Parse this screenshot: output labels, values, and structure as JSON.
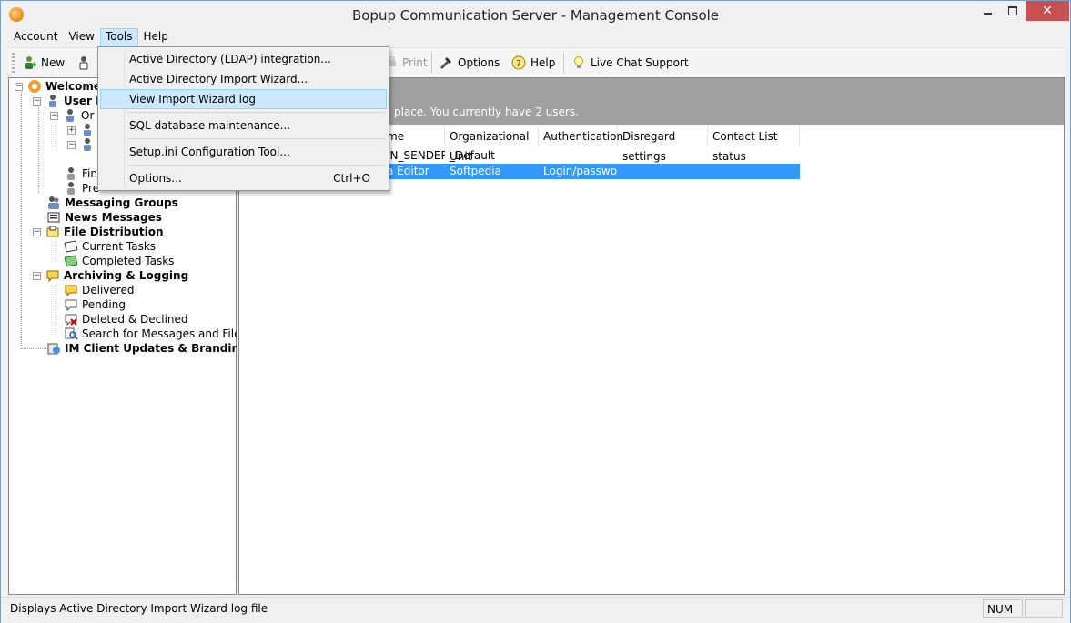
{
  "window": {
    "title": "Bopup Communication Server - Management Console",
    "close_glyph": "✕"
  },
  "menubar": {
    "items": [
      {
        "label": "Account"
      },
      {
        "label": "View"
      },
      {
        "label": "Tools"
      },
      {
        "label": "Help"
      }
    ],
    "active": "Tools"
  },
  "toolbar": {
    "new_label": "New",
    "print_label": "Print",
    "options_label": "Options",
    "help_label": "Help",
    "live_chat_label": "Live Chat Support"
  },
  "tree": {
    "welcome": "Welcome",
    "user_management": "User M",
    "org_units": "Or",
    "find_users": "Fin",
    "presence": "Pre",
    "messaging_groups": "Messaging Groups",
    "news_messages": "News Messages",
    "file_distribution": "File Distribution",
    "current_tasks": "Current Tasks",
    "completed_tasks": "Completed Tasks",
    "archiving_logging": "Archiving & Logging",
    "delivered": "Delivered",
    "pending": "Pending",
    "deleted_declined": "Deleted & Declined",
    "search_messages": "Search for Messages and Files",
    "im_client_updates": "IM Client Updates & Branding"
  },
  "content": {
    "banner_text": "place. You currently have 2 users.",
    "columns": [
      {
        "label": "me"
      },
      {
        "label": "Organizational Unit"
      },
      {
        "label": "Authentication"
      },
      {
        "label": "Disregard settings"
      },
      {
        "label": "Contact List status"
      }
    ],
    "rows": [
      {
        "name": "IN_SENDER",
        "ou": "_Default",
        "auth": "",
        "disregard": "",
        "status": ""
      },
      {
        "name": "a Editor",
        "ou": "Softpedia",
        "auth": "Login/password",
        "disregard": "",
        "status": ""
      }
    ]
  },
  "tools_menu": {
    "items": [
      {
        "label": "Active Directory (LDAP) integration..."
      },
      {
        "label": "Active Directory Import Wizard..."
      },
      {
        "label": "View Import Wizard log"
      },
      {
        "label": "SQL database maintenance..."
      },
      {
        "label": "Setup.ini Configuration Tool..."
      },
      {
        "label": "Options...",
        "shortcut": "Ctrl+O"
      }
    ],
    "highlighted": "View Import Wizard log"
  },
  "statusbar": {
    "text": "Displays Active Directory Import Wizard log file",
    "num": "NUM"
  },
  "colors": {
    "selection": "#3399ff",
    "menu_highlight": "#cce8ff",
    "banner": "#a0a0a0",
    "close_button": "#c75050"
  }
}
